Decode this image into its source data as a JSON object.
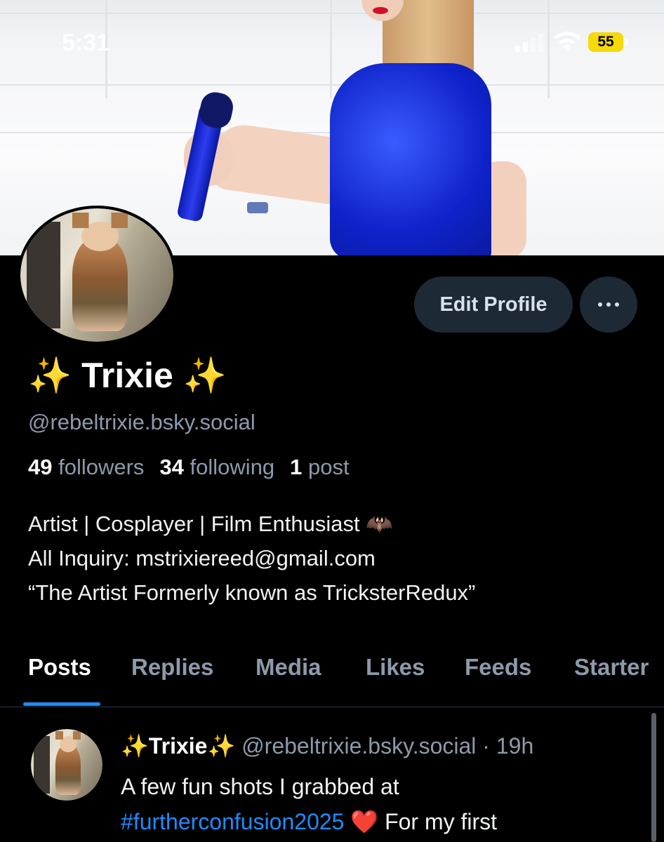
{
  "status_bar": {
    "time": "5:31",
    "battery": "55"
  },
  "profile": {
    "display_name": "✨ Trixie ✨",
    "handle": "@rebeltrixie.bsky.social",
    "stats": {
      "followers_count": "49",
      "followers_label": "followers",
      "following_count": "34",
      "following_label": "following",
      "posts_count": "1",
      "posts_label": "post"
    },
    "bio": [
      "Artist | Cosplayer | Film Enthusiast 🦇",
      "All Inquiry: mstrixiereed@gmail.com",
      "“The Artist Formerly known as TricksterRedux”"
    ],
    "edit_button": "Edit Profile",
    "more_button": "•••"
  },
  "tabs": [
    "Posts",
    "Replies",
    "Media",
    "Likes",
    "Feeds",
    "Starter"
  ],
  "active_tab": "Posts",
  "post": {
    "author": "✨Trixie✨",
    "handle": "@rebeltrixie.bsky.social",
    "separator": " · ",
    "age": "19h",
    "text_line1": "A few fun shots I grabbed at",
    "hashtag": "#furtherconfusion2025",
    "emoji": " ❤️ ",
    "text_line2_rest": "For my first"
  },
  "colors": {
    "accent": "#1f8bff",
    "muted": "#8d9aab",
    "button_bg": "#1e2936",
    "battery": "#f5d90a"
  }
}
